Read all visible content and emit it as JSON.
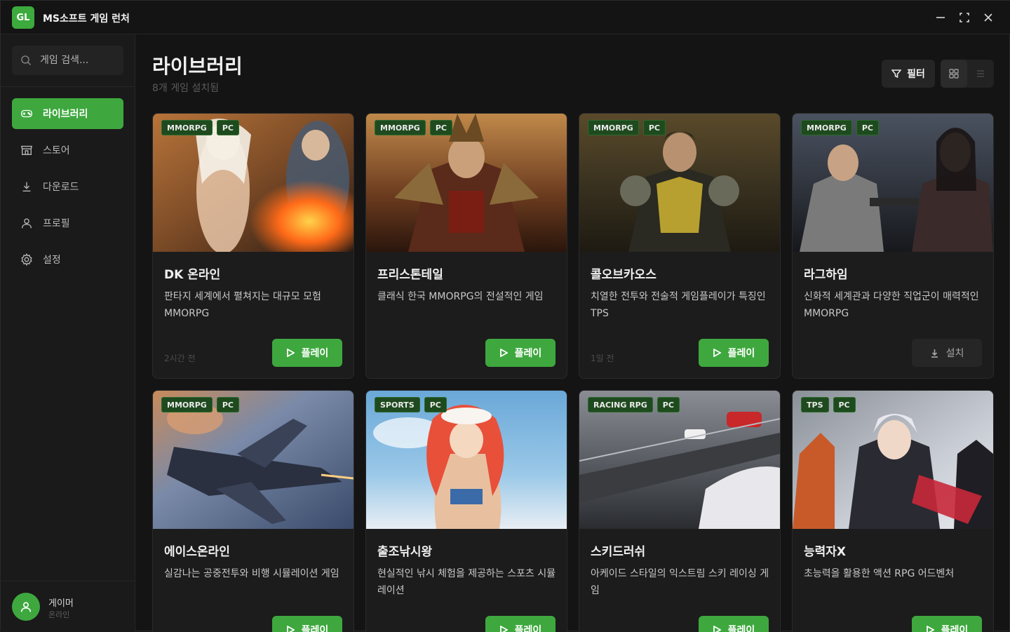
{
  "app": {
    "logo": "GL",
    "title": "MS소프트 게임 런처"
  },
  "window_controls": [
    "minimize-icon",
    "maximize-icon",
    "close-icon"
  ],
  "search": {
    "placeholder": "게임 검색..."
  },
  "nav": [
    {
      "label": "라이브러리",
      "icon": "gamepad-icon",
      "active": true
    },
    {
      "label": "스토어",
      "icon": "store-icon",
      "active": false
    },
    {
      "label": "다운로드",
      "icon": "download-icon",
      "active": false
    },
    {
      "label": "프로필",
      "icon": "user-icon",
      "active": false
    },
    {
      "label": "설정",
      "icon": "gear-icon",
      "active": false
    }
  ],
  "user": {
    "name": "게이머",
    "status": "온라인"
  },
  "main": {
    "title": "라이브러리",
    "subtitle": "8개 게임 설치됨",
    "filter_label": "필터",
    "view_modes": [
      "grid-view-icon",
      "list-view-icon"
    ]
  },
  "games": [
    {
      "genre": "MMORPG",
      "platform": "PC",
      "title": "DK 온라인",
      "desc": "판타지 세계에서 펼쳐지는 대규모 모험 MMORPG",
      "time": "2시간 전",
      "action": "플레이",
      "installed": true
    },
    {
      "genre": "MMORPG",
      "platform": "PC",
      "title": "프리스톤테일",
      "desc": "클래식 한국 MMORPG의 전설적인 게임",
      "time": "",
      "action": "플레이",
      "installed": true
    },
    {
      "genre": "MMORPG",
      "platform": "PC",
      "title": "콜오브카오스",
      "desc": "치열한 전투와 전술적 게임플레이가 특징인 TPS",
      "time": "1일 전",
      "action": "플레이",
      "installed": true
    },
    {
      "genre": "MMORPG",
      "platform": "PC",
      "title": "라그하임",
      "desc": "신화적 세계관과 다양한 직업군이 매력적인 MMORPG",
      "time": "",
      "action": "설치",
      "installed": false
    },
    {
      "genre": "MMORPG",
      "platform": "PC",
      "title": "에이스온라인",
      "desc": "실감나는 공중전투와 비행 시뮬레이션 게임",
      "time": "",
      "action": "플레이",
      "installed": true
    },
    {
      "genre": "SPORTS",
      "platform": "PC",
      "title": "출조낚시왕",
      "desc": "현실적인 낚시 체험을 제공하는 스포츠 시뮬레이션",
      "time": "",
      "action": "플레이",
      "installed": true
    },
    {
      "genre": "RACING RPG",
      "platform": "PC",
      "title": "스키드러쉬",
      "desc": "아케이드 스타일의 익스트림 스키 레이싱 게임",
      "time": "",
      "action": "플레이",
      "installed": true
    },
    {
      "genre": "TPS",
      "platform": "PC",
      "title": "능력자X",
      "desc": "초능력을 활용한 액션 RPG 어드벤처",
      "time": "",
      "action": "플레이",
      "installed": true
    }
  ],
  "colors": {
    "accent": "#3ea83e",
    "background": "#141414",
    "sidebar": "#1a1a1a",
    "card": "#1c1c1c"
  }
}
